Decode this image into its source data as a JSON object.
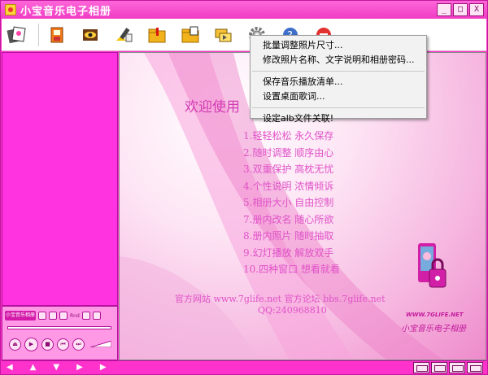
{
  "window": {
    "title": "小宝音乐电子相册"
  },
  "titlebar": {
    "minimize": "_",
    "maximize": "□",
    "close": "X"
  },
  "toolbar": {
    "tools": [
      {
        "icon": "photos-icon"
      },
      {
        "icon": "save-album-icon"
      },
      {
        "icon": "eye-preview-icon"
      },
      {
        "icon": "edit-brush-icon"
      },
      {
        "icon": "folder-music-icon"
      },
      {
        "icon": "folder-photo-icon"
      },
      {
        "icon": "slideshow-icon"
      },
      {
        "icon": "settings-gear-icon"
      },
      {
        "icon": "help-icon"
      },
      {
        "icon": "exit-icon"
      }
    ]
  },
  "menu": {
    "items": [
      "批量调整照片尺寸...",
      "修改照片名称、文字说明和相册密码...",
      "保存音乐播放清单...",
      "设置桌面歌词...",
      "设定alb文件关联!"
    ]
  },
  "main": {
    "welcome": "欢迎使用",
    "features": [
      "1.轻轻松松 永久保存",
      "2.随时调整 顺序由心",
      "3.双重保护 高枕无忧",
      "4.个性说明 浓情倾诉",
      "5.相册大小 自由控制",
      "7.册内改名 随心所欲",
      "8.册内照片 随时抽取",
      "9.幻灯播放 解放双手",
      "10.四种窗口 想看就看"
    ],
    "site_line": "官方网站 www.7glife.net 官方论坛 bbs.7glife.net",
    "qq_line": "QQ:240968810",
    "brand_url": "WWW.7GLIFE.NET",
    "brand_name": "小宝音乐电子相册"
  },
  "player": {
    "logo": "小宝音乐相册",
    "rnd_label": "Rnd",
    "controls": [
      "⏏",
      "▶",
      "■",
      "⏮",
      "⏭"
    ]
  },
  "bottombar": {
    "arrows": [
      "◀",
      "▲",
      "▼",
      "▶",
      "▶"
    ]
  },
  "colors": {
    "accent": "#ff33cc",
    "text_pink": "#e052c8",
    "menu_bg": "#f2f2f2"
  }
}
